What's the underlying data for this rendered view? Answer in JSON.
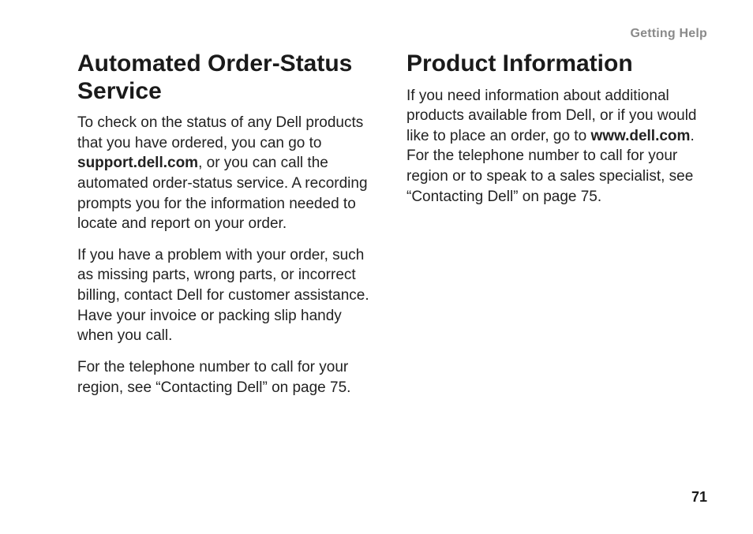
{
  "header": {
    "running_head": "Getting Help"
  },
  "left": {
    "title": "Automated Order-Status Service",
    "p1_a": "To check on the status of any Dell products that you have ordered, you can go to ",
    "p1_bold": "support.dell.com",
    "p1_b": ", or you can call the automated order-status service. A recording prompts you for the information needed to locate and report on your order.",
    "p2": "If you have a problem with your order, such as missing parts, wrong parts, or incorrect billing, contact Dell for customer assistance. Have your invoice or packing slip handy when you call.",
    "p3": "For the telephone number to call for your region, see “Contacting Dell” on page 75."
  },
  "right": {
    "title": "Product Information",
    "p1_a": "If you need information about additional products available from Dell, or if you would like to place an order, go to ",
    "p1_bold": "www.dell.com",
    "p1_b": ". For the telephone number to call for your region or to speak to a sales specialist, see “Contacting Dell” on page 75."
  },
  "footer": {
    "page_number": "71"
  }
}
